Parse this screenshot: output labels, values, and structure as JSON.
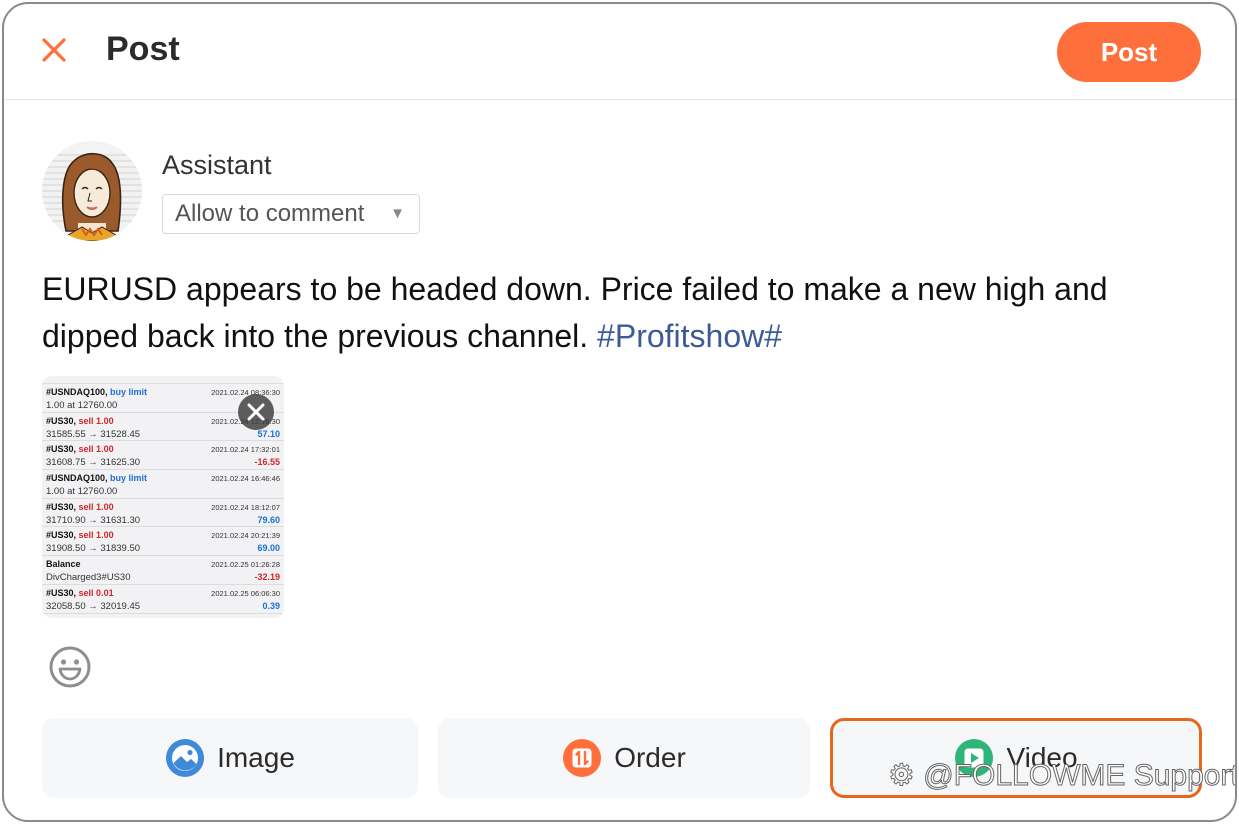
{
  "header": {
    "title": "Post",
    "close_icon": "close-icon",
    "post_button": "Post"
  },
  "author": {
    "name": "Assistant",
    "avatar": "avatar-woman-illustration",
    "comment_setting": "Allow to comment",
    "comment_caret": "▼"
  },
  "post": {
    "text": "EURUSD appears to be headed down. Price failed to make a new high and dipped back into the previous channel. ",
    "hashtag": "#Profitshow#"
  },
  "attachment": {
    "remove_icon": "close-icon",
    "trades": [
      {
        "symbol": "#USNDAQ100,",
        "action": "buy limit",
        "action_type": "buy",
        "time": "2021.02.24 08:36:30",
        "detail": "1.00 at 12760.00",
        "pnl": "",
        "pnl_type": ""
      },
      {
        "symbol": "#US30,",
        "action": "sell 1.00",
        "action_type": "sell",
        "time": "2021.02.24 12:16:30",
        "detail": "31585.55 → 31528.45",
        "pnl": "57.10",
        "pnl_type": "pos"
      },
      {
        "symbol": "#US30,",
        "action": "sell 1.00",
        "action_type": "sell",
        "time": "2021.02.24 17:32:01",
        "detail": "31608.75 → 31625.30",
        "pnl": "-16.55",
        "pnl_type": "neg"
      },
      {
        "symbol": "#USNDAQ100,",
        "action": "buy limit",
        "action_type": "buy",
        "time": "2021.02.24 16:46:46",
        "detail": "1.00 at 12760.00",
        "pnl": "",
        "pnl_type": ""
      },
      {
        "symbol": "#US30,",
        "action": "sell 1.00",
        "action_type": "sell",
        "time": "2021.02.24 18:12:07",
        "detail": "31710.90 → 31631.30",
        "pnl": "79.60",
        "pnl_type": "pos"
      },
      {
        "symbol": "#US30,",
        "action": "sell 1.00",
        "action_type": "sell",
        "time": "2021.02.24 20:21:39",
        "detail": "31908.50 → 31839.50",
        "pnl": "69.00",
        "pnl_type": "pos"
      },
      {
        "symbol": "Balance",
        "action": "",
        "action_type": "",
        "time": "2021.02.25 01:26:28",
        "detail": "DivCharged3#US30",
        "pnl": "-32.19",
        "pnl_type": "neg"
      },
      {
        "symbol": "#US30,",
        "action": "sell 0.01",
        "action_type": "sell",
        "time": "2021.02.25 06:06:30",
        "detail": "32058.50 → 32019.45",
        "pnl": "0.39",
        "pnl_type": "pos"
      }
    ]
  },
  "toolbar": {
    "emoji_icon": "emoji-smile-icon"
  },
  "actions": {
    "image_label": "Image",
    "order_label": "Order",
    "video_label": "Video"
  },
  "watermark": "@FOLLOWME Support",
  "colors": {
    "accent": "#ff6f3c",
    "hashtag": "#3d5a98",
    "image_icon": "#3f8ad8",
    "order_icon": "#ff6f3c",
    "video_icon": "#2fb57a",
    "video_highlight_border": "#e4671c",
    "buy": "#1a6fd6",
    "sell": "#d0262a"
  }
}
